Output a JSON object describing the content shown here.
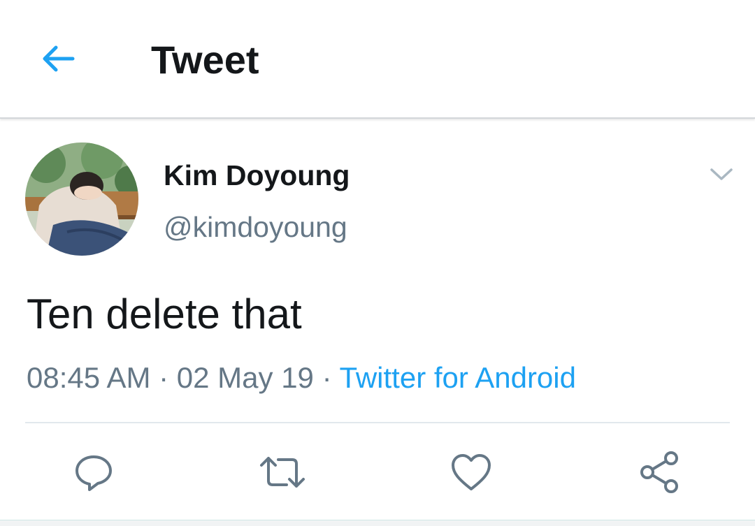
{
  "header": {
    "title": "Tweet",
    "back_icon": "arrow-left-icon"
  },
  "tweet": {
    "author": {
      "display_name": "Kim Doyoung",
      "handle": "@kimdoyoung"
    },
    "text": "Ten delete that",
    "meta": {
      "time": "08:45 AM",
      "separator": " · ",
      "date": "02 May 19",
      "source": "Twitter for Android"
    }
  },
  "actions": [
    {
      "name": "reply",
      "icon": "reply-icon"
    },
    {
      "name": "retweet",
      "icon": "retweet-icon"
    },
    {
      "name": "like",
      "icon": "heart-icon"
    },
    {
      "name": "share",
      "icon": "share-icon"
    }
  ],
  "colors": {
    "accent": "#1da1f2",
    "text": "#14171a",
    "secondary": "#657786",
    "icon": "#657786",
    "divider": "#e1e8ed"
  }
}
